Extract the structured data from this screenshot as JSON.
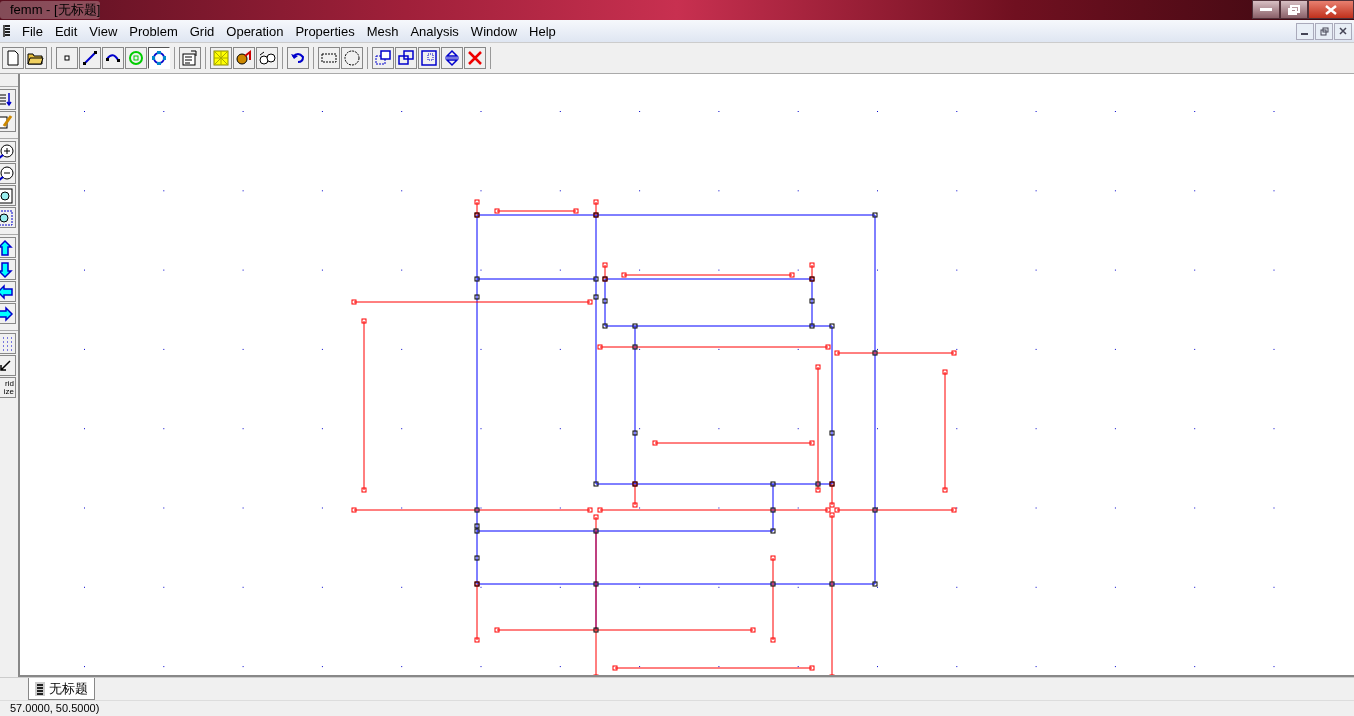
{
  "window": {
    "title": "femm - [无标题]"
  },
  "menu": [
    "File",
    "Edit",
    "View",
    "Problem",
    "Grid",
    "Operation",
    "Properties",
    "Mesh",
    "Analysis",
    "Window",
    "Help"
  ],
  "toolbar": {
    "groups": [
      [
        {
          "kind": "new",
          "selected": false
        },
        {
          "kind": "open",
          "selected": false
        }
      ],
      [
        {
          "kind": "node",
          "selected": false
        },
        {
          "kind": "segment",
          "selected": false
        },
        {
          "kind": "arc",
          "selected": false
        },
        {
          "kind": "block",
          "selected": false
        },
        {
          "kind": "group",
          "selected": true
        }
      ],
      [
        {
          "kind": "properties",
          "selected": false
        }
      ],
      [
        {
          "kind": "mesh",
          "selected": false
        },
        {
          "kind": "run",
          "selected": false
        },
        {
          "kind": "view",
          "selected": false
        }
      ],
      [
        {
          "kind": "undo",
          "selected": false
        }
      ],
      [
        {
          "kind": "rect-select",
          "selected": false
        },
        {
          "kind": "circle-select",
          "selected": false
        }
      ],
      [
        {
          "kind": "copy",
          "selected": false
        },
        {
          "kind": "move",
          "selected": false
        },
        {
          "kind": "scale",
          "selected": false
        },
        {
          "kind": "mirror",
          "selected": false
        },
        {
          "kind": "delete",
          "selected": false
        }
      ]
    ]
  },
  "side_toolbar": {
    "groups": [
      [
        {
          "kind": "list"
        },
        {
          "kind": "edit"
        }
      ],
      [
        {
          "kind": "zoom-in"
        },
        {
          "kind": "zoom-out"
        },
        {
          "kind": "zoom-fit"
        },
        {
          "kind": "zoom-window"
        }
      ],
      [
        {
          "kind": "up"
        },
        {
          "kind": "down"
        },
        {
          "kind": "left"
        },
        {
          "kind": "right"
        }
      ],
      [
        {
          "kind": "grid"
        },
        {
          "kind": "snap"
        },
        {
          "kind": "text",
          "label": "rid ize"
        }
      ]
    ]
  },
  "tabs": [
    {
      "label": "无标题",
      "selected": true
    }
  ],
  "status_bar": {
    "text": "57.0000, 50.5000)"
  }
}
